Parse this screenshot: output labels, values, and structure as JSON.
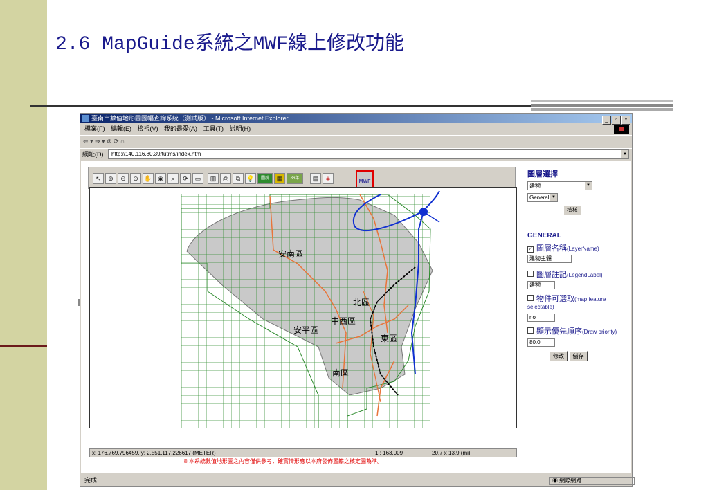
{
  "slide": {
    "title": "2.6 MapGuide系統之MWF線上修改功能"
  },
  "browser": {
    "window_title": "臺南市數值地形圖圖幅查詢系統（測試版） - Microsoft Internet Explorer",
    "menu": [
      "檔案(F)",
      "編輯(E)",
      "檢視(V)",
      "我的最愛(A)",
      "工具(T)",
      "說明(H)"
    ],
    "nav_buttons": "⇐ ▾ ⇒ ▾ ⊗ ⟳ ⌂",
    "address_label": "網址(D)",
    "address_url": "http://140.116.80.39/tutms/index.htm",
    "status_done": "完成",
    "status_zone": "網際網路"
  },
  "map": {
    "mwf_label": "MWF",
    "toolbar_text_icons": {
      "legend": "圖說",
      "year": "86年"
    },
    "district_labels": {
      "annan": "安南區",
      "north": "北區",
      "westcentral": "中西區",
      "anping": "安平區",
      "east": "東區",
      "south": "南區"
    },
    "status": {
      "coords": "x: 176,769.796459, y: 2,551,117.226617 (METER)",
      "scale": "1 : 163,009",
      "extent": "20.7 x 13.9 (mi)"
    },
    "disclaimer": "※本系統數值地形圖之內容僅供參考，確實情形應以本府發佈置籍之核定圖為準。"
  },
  "layer_panel": {
    "heading": "圖層選擇",
    "layer_select": "建物",
    "style_select": "General",
    "check_button": "檢核",
    "section_title": "GENERAL",
    "layer_name_label": "圖層名稱",
    "layer_name_en": "(LayerName)",
    "layer_name_value": "建物主體",
    "legend_label": "圖層註記",
    "legend_en": "(LegendLabel)",
    "legend_value": "建物",
    "selectable_label": "物件可選取",
    "selectable_en": "(map feature selectable)",
    "selectable_value": "no",
    "priority_label": "顯示優先順序",
    "priority_en": "(Draw priority)",
    "priority_value": "80.0",
    "modify_button": "修改",
    "save_button": "儲存"
  },
  "colors": {
    "title": "#1a1a8c",
    "sidebar": "#d3d4a2",
    "grid": "#2e8b2e",
    "river": "#1030d0",
    "roads": "#e8753a",
    "highlight": "#e00000"
  }
}
